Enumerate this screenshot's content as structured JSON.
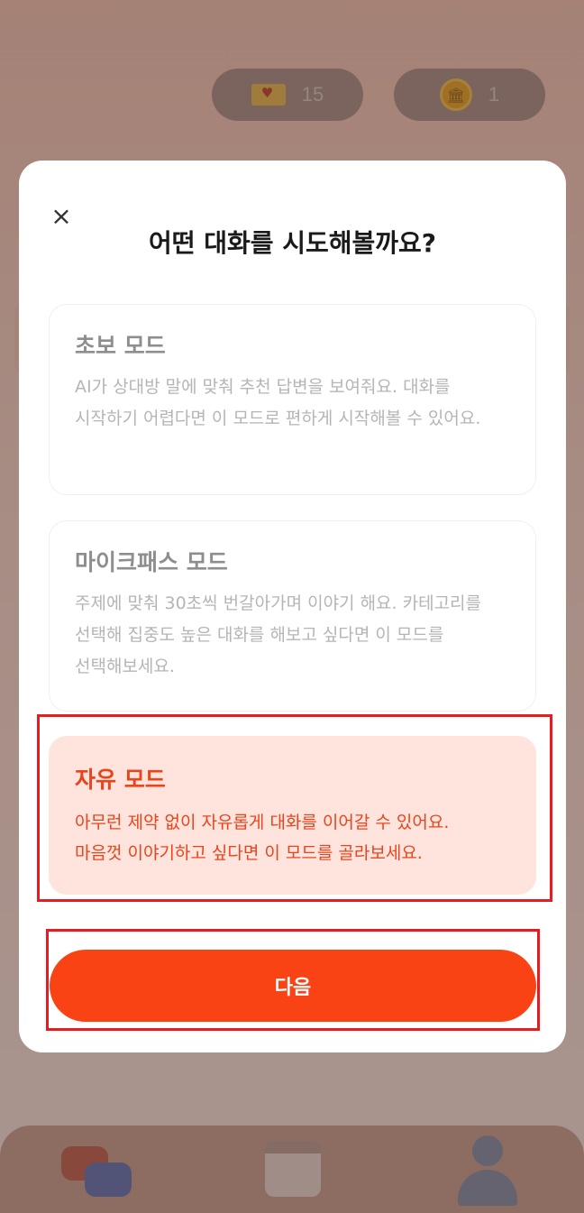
{
  "header": {
    "ticket_count": "15",
    "coin_count": "1",
    "ticket_icon": "ticket-icon",
    "coin_icon": "coin-icon"
  },
  "modal": {
    "close_icon": "×",
    "title": "어떤 대화를 시도해볼까요?",
    "modes": [
      {
        "name": "초보 모드",
        "description": "AI가 상대방 말에 맞춰 추천 답변을 보여줘요. 대화를 시작하기 어렵다면 이 모드로 편하게 시작해볼 수 있어요.",
        "selected": false
      },
      {
        "name": "마이크패스 모드",
        "description": "주제에 맞춰 30초씩 번갈아가며 이야기 해요. 카테고리를 선택해 집중도 높은 대화를 해보고 싶다면 이 모드를 선택해보세요.",
        "selected": false
      },
      {
        "name": "자유 모드",
        "description_line1": "아무런 제약 없이 자유롭게 대화를 이어갈 수 있어요.",
        "description_line2": "마음껏 이야기하고 싶다면 이 모드를 골라보세요.",
        "selected": true
      }
    ],
    "next_label": "다음"
  },
  "tabbar": {
    "items": [
      "chat-icon",
      "calendar-icon",
      "profile-icon"
    ]
  },
  "colors": {
    "accent": "#fa4314",
    "selected_bg": "#ffe4dd",
    "selected_text": "#e8451d",
    "highlight": "#e51c23"
  }
}
